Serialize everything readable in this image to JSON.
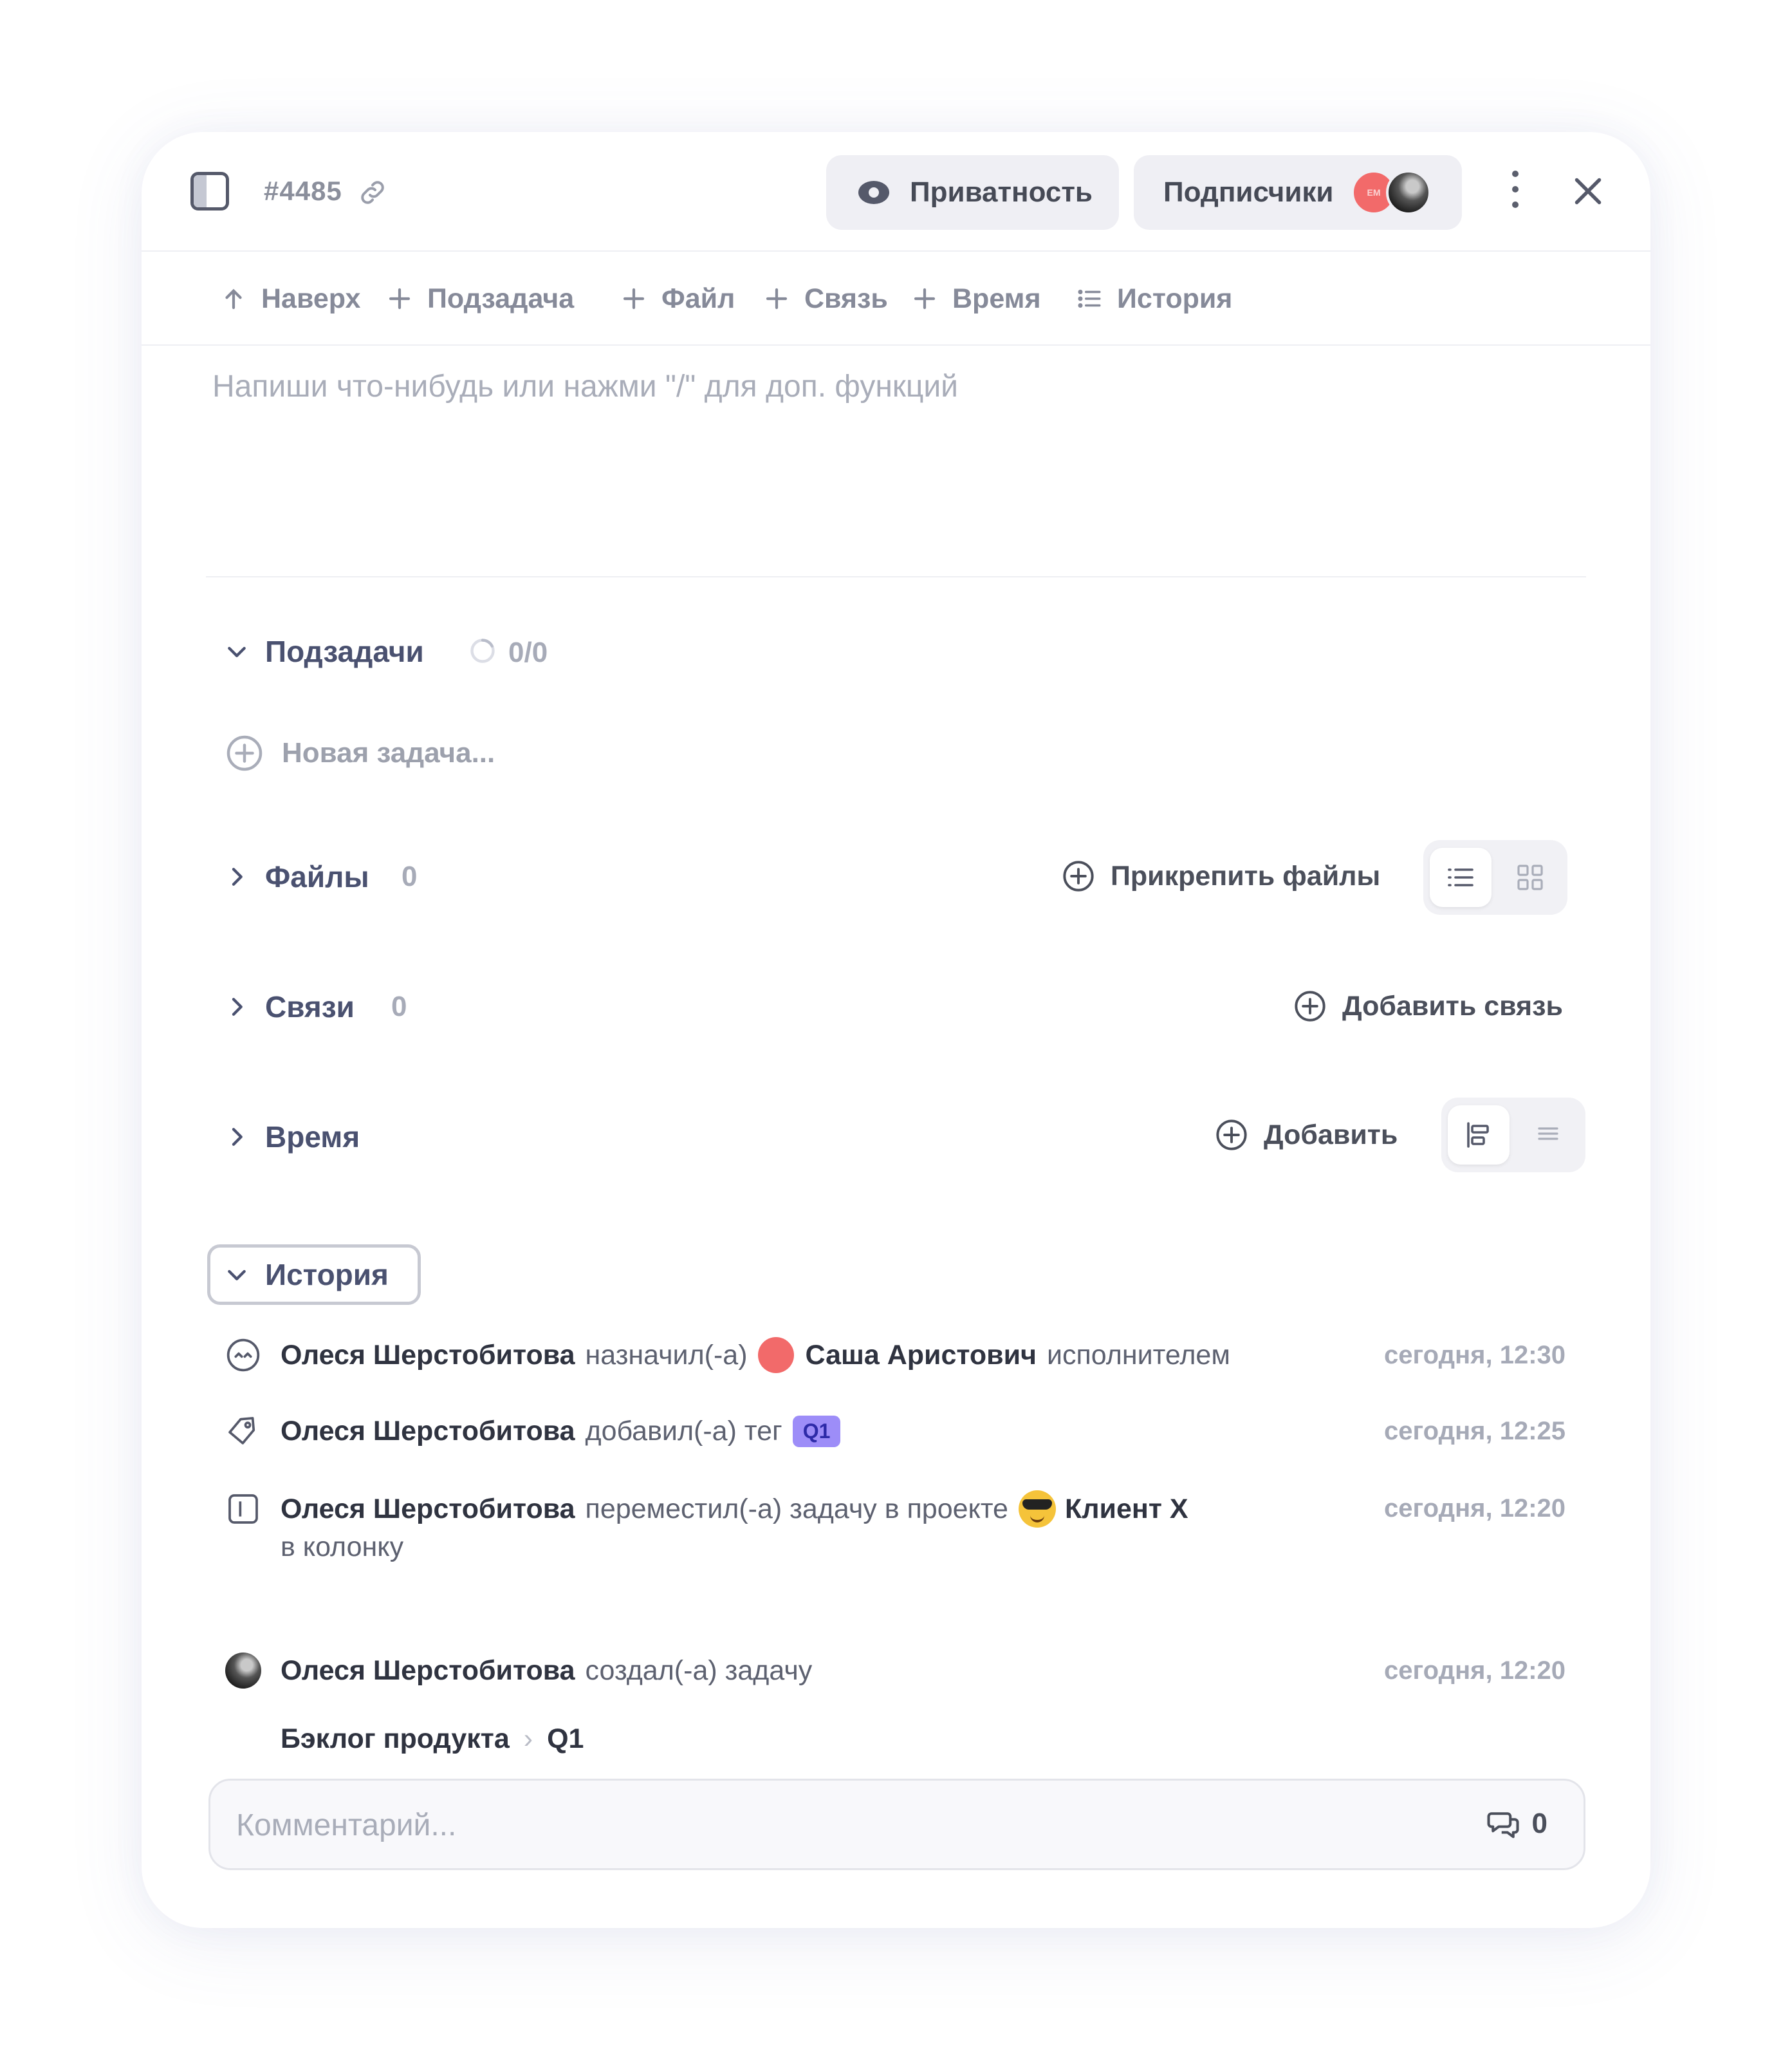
{
  "header": {
    "task_id": "#4485",
    "privacy_label": "Приватность",
    "subscribers_label": "Подписчики",
    "avatar_initials": "ЕМ"
  },
  "toolbar": {
    "up": "Наверх",
    "subtask": "Подзадача",
    "file": "Файл",
    "link": "Связь",
    "time": "Время",
    "history": "История"
  },
  "editor": {
    "placeholder": "Напиши что-нибудь или нажми \"/\" для доп. функций"
  },
  "sections": {
    "subtasks": {
      "title": "Подзадачи",
      "progress": "0/0",
      "new_task_placeholder": "Новая задача..."
    },
    "files": {
      "title": "Файлы",
      "count": "0",
      "action": "Прикрепить файлы"
    },
    "links": {
      "title": "Связи",
      "count": "0",
      "action": "Добавить связь"
    },
    "time": {
      "title": "Время",
      "action": "Добавить"
    },
    "history": {
      "title": "История"
    }
  },
  "history": [
    {
      "icon": "assign-icon",
      "actor": "Олеся Шерстобитова",
      "verb": "назначил(-а)",
      "target": "Саша Аристович",
      "suffix": "исполнителем",
      "time": "сегодня, 12:30"
    },
    {
      "icon": "tag-icon",
      "actor": "Олеся Шерстобитова",
      "verb": "добавил(-а) тег",
      "tag": "Q1",
      "time": "сегодня, 12:25"
    },
    {
      "icon": "board-icon",
      "actor": "Олеся Шерстобитова",
      "verb": "переместил(-а) задачу в проекте",
      "project": "Клиент X",
      "line2": "в колонку",
      "from": "Бэклог продукта",
      "to": "Q1",
      "time": "сегодня, 12:20"
    },
    {
      "icon": "user-avatar",
      "actor": "Олеся Шерстобитова",
      "verb": "создал(-а) задачу",
      "time": "сегодня, 12:20"
    }
  ],
  "comment": {
    "placeholder": "Комментарий...",
    "count": "0"
  },
  "colors": {
    "accent_red": "#f26a6a",
    "tag_bg": "#9d8df8",
    "heading": "#4a5170"
  }
}
